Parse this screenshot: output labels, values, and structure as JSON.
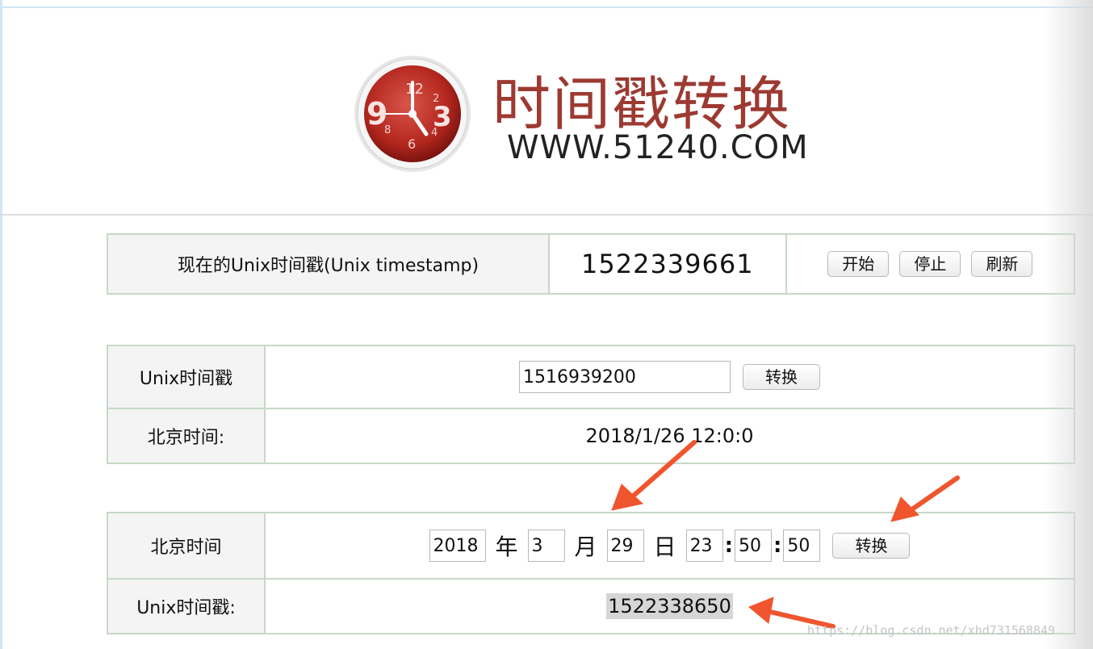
{
  "logo": {
    "title": "时间戳转换",
    "url": "WWW.51240.COM"
  },
  "now_panel": {
    "label": "现在的Unix时间戳(Unix timestamp)",
    "value": "1522339661",
    "buttons": {
      "start": "开始",
      "stop": "停止",
      "refresh": "刷新"
    }
  },
  "unix_to_date": {
    "label": "Unix时间戳",
    "input_value": "1516939200",
    "convert_label": "转换",
    "result_label": "北京时间:",
    "result_value": "2018/1/26 12:0:0"
  },
  "date_to_unix": {
    "label": "北京时间",
    "year": "2018",
    "year_unit": "年",
    "month": "3",
    "month_unit": "月",
    "day": "29",
    "day_unit": "日",
    "hour": "23",
    "minute": "50",
    "second": "50",
    "colon": ":",
    "convert_label": "转换",
    "result_label": "Unix时间戳:",
    "result_value": "1522338650"
  },
  "watermark": "https://blog.csdn.net/xhd731568849",
  "colors": {
    "accent_red": "#9c3a32",
    "arrow": "#f0552e",
    "border": "#c7d8c7"
  },
  "icons": [
    "clock-logo-icon",
    "arrow-annotation"
  ]
}
